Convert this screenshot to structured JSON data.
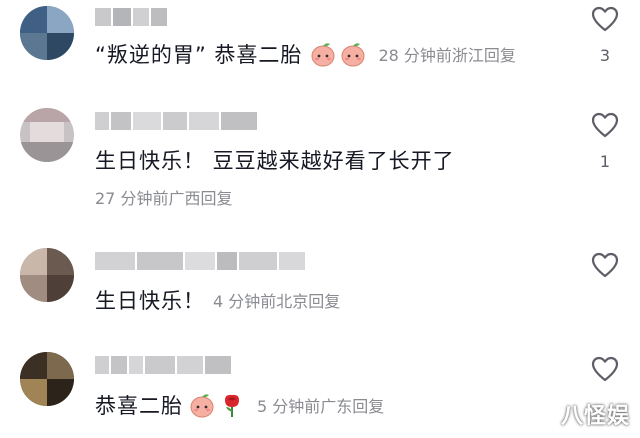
{
  "comments": [
    {
      "username_redacted": true,
      "content_parts": [
        "“叛逆的胃” 恭喜二胎"
      ],
      "emojis": [
        "peach-face-emoji",
        "peach-face-emoji"
      ],
      "time": "28 分钟前",
      "location": "浙江",
      "reply_label": "回复",
      "like_count": "3"
    },
    {
      "username_redacted": true,
      "content_parts": [
        "生日快乐！ 豆豆越来越好看了长开了"
      ],
      "emojis": [],
      "time": "27 分钟前",
      "location": "广西",
      "reply_label": "回复",
      "like_count": "1"
    },
    {
      "username_redacted": true,
      "content_parts": [
        "生日快乐！"
      ],
      "emojis": [],
      "time": "4 分钟前",
      "location": "北京",
      "reply_label": "回复",
      "like_count": ""
    },
    {
      "username_redacted": true,
      "content_parts": [
        "恭喜二胎"
      ],
      "emojis": [
        "peach-face-emoji",
        "rose-emoji"
      ],
      "time": "5 分钟前",
      "location": "广东",
      "reply_label": "回复",
      "like_count": ""
    }
  ],
  "watermark": "八怪娱",
  "colors": {
    "text": "#161823",
    "meta": "#8a8b91",
    "heart_outline": "#5d5e66",
    "peach": "#f6b0a3",
    "rose": "#d9262c"
  }
}
